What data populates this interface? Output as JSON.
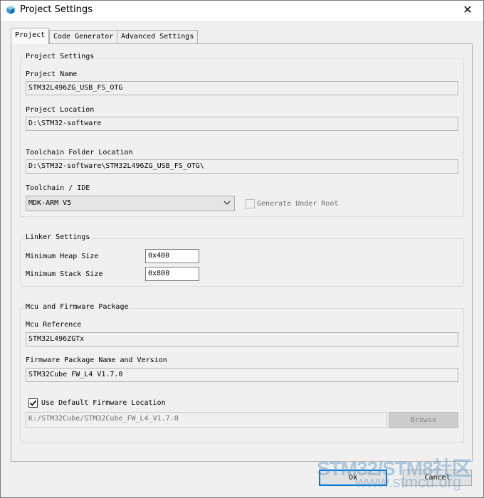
{
  "window": {
    "title": "Project Settings",
    "close_glyph": "✕"
  },
  "tabs": [
    {
      "label": "Project",
      "active": true
    },
    {
      "label": "Code Generator",
      "active": false
    },
    {
      "label": "Advanced Settings",
      "active": false
    }
  ],
  "project_settings": {
    "group_title": "Project Settings",
    "name_label": "Project Name",
    "name_value": "STM32L496ZG_USB_FS_OTG",
    "location_label": "Project Location",
    "location_value": "D:\\STM32-software",
    "toolchain_folder_label": "Toolchain Folder Location",
    "toolchain_folder_value": "D:\\STM32-software\\STM32L496ZG_USB_FS_OTG\\",
    "toolchain_label": "Toolchain / IDE",
    "toolchain_value": "MDK-ARM V5",
    "generate_under_root_label": "Generate Under Root",
    "generate_under_root_checked": false
  },
  "linker_settings": {
    "group_title": "Linker Settings",
    "heap_label": "Minimum Heap Size",
    "heap_value": "0x400",
    "stack_label": "Minimum Stack Size",
    "stack_value": "0x800"
  },
  "mcu_package": {
    "group_title": "Mcu and Firmware Package",
    "mcu_ref_label": "Mcu Reference",
    "mcu_ref_value": "STM32L496ZGTx",
    "fw_label": "Firmware Package Name and Version",
    "fw_value": "STM32Cube FW_L4 V1.7.0",
    "default_location_label": "Use Default Firmware Location",
    "default_location_checked": true,
    "fw_location_value": "K:/STM32Cube/STM32Cube_FW_L4_V1.7.0",
    "browse_label": "Browse"
  },
  "footer": {
    "ok_label": "Ok",
    "cancel_label": "Cancel"
  },
  "watermark": {
    "line1": "STM32/STM8社区",
    "line2": "www.stmcu.org"
  },
  "colors": {
    "accent": "#0078d7",
    "icon": "#2f9bd8"
  }
}
